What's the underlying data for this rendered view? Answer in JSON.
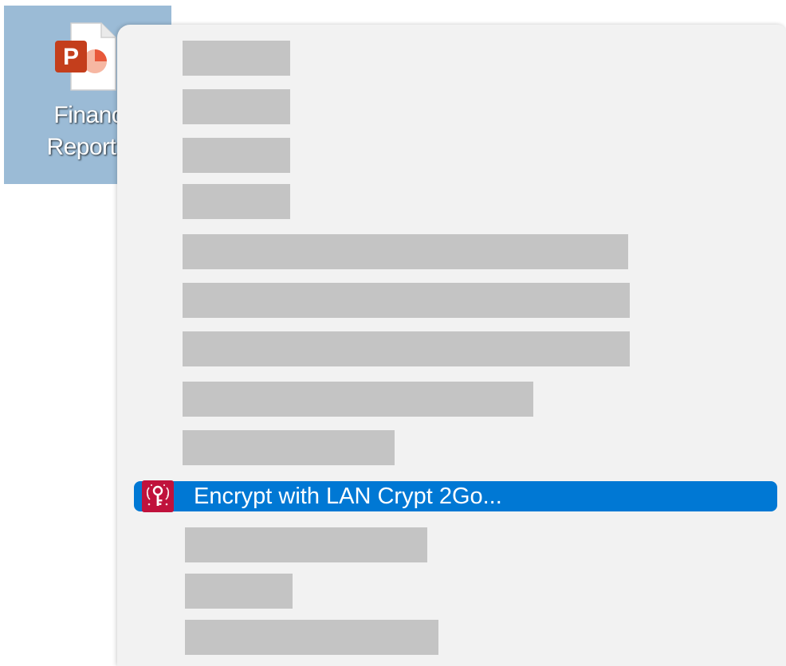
{
  "desktop": {
    "file": {
      "name_line1": "Financi",
      "name_line2": "Report.p",
      "icon": "powerpoint-file-icon",
      "selected_color": "#9bbbd6"
    }
  },
  "context_menu": {
    "highlighted_item": {
      "label": "Encrypt with LAN Crypt 2Go...",
      "icon": "lan-crypt-icon",
      "icon_color": "#c0123c",
      "highlight_color": "#0078d4"
    },
    "redacted_items": 12,
    "background": "#f2f2f2",
    "redaction_color": "#c4c4c4"
  }
}
